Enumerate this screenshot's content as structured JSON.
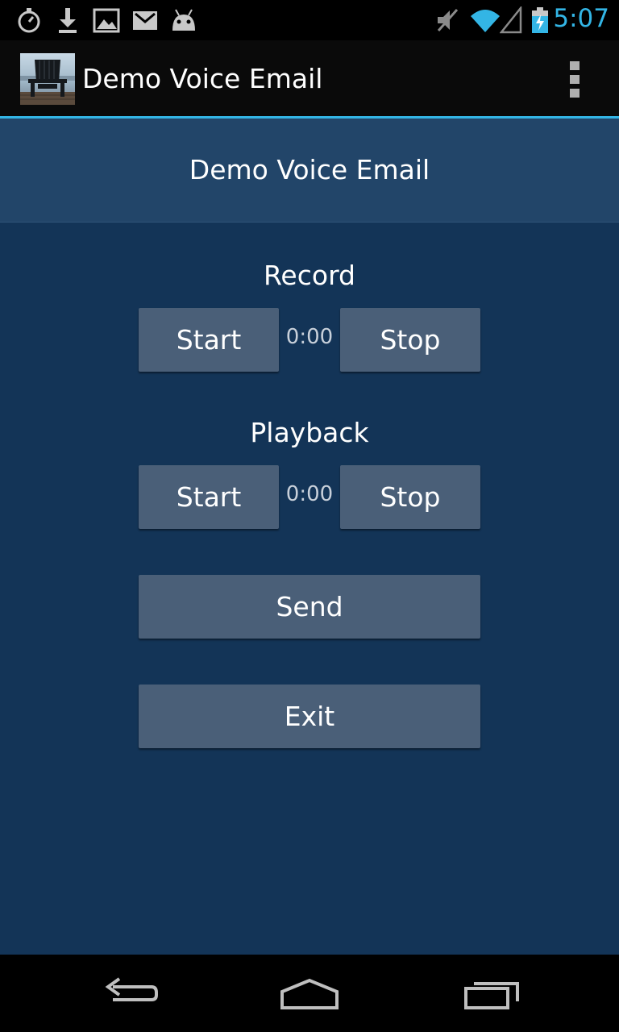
{
  "status_bar": {
    "time": "5:07",
    "icons_left": [
      "stopwatch-icon",
      "download-icon",
      "image-icon",
      "gmail-icon",
      "android-icon"
    ],
    "icons_right": [
      "mute-icon",
      "wifi-icon",
      "signal-icon",
      "battery-charging-icon"
    ],
    "accent_color": "#33b5e5"
  },
  "action_bar": {
    "title": "Demo Voice Email"
  },
  "header": {
    "title": "Demo Voice Email"
  },
  "record": {
    "label": "Record",
    "start_label": "Start",
    "timer": "0:00",
    "stop_label": "Stop"
  },
  "playback": {
    "label": "Playback",
    "start_label": "Start",
    "timer": "0:00",
    "stop_label": "Stop"
  },
  "send_label": "Send",
  "exit_label": "Exit",
  "colors": {
    "background": "#133457",
    "header_band": "#224569",
    "button": "#4a5f78"
  }
}
